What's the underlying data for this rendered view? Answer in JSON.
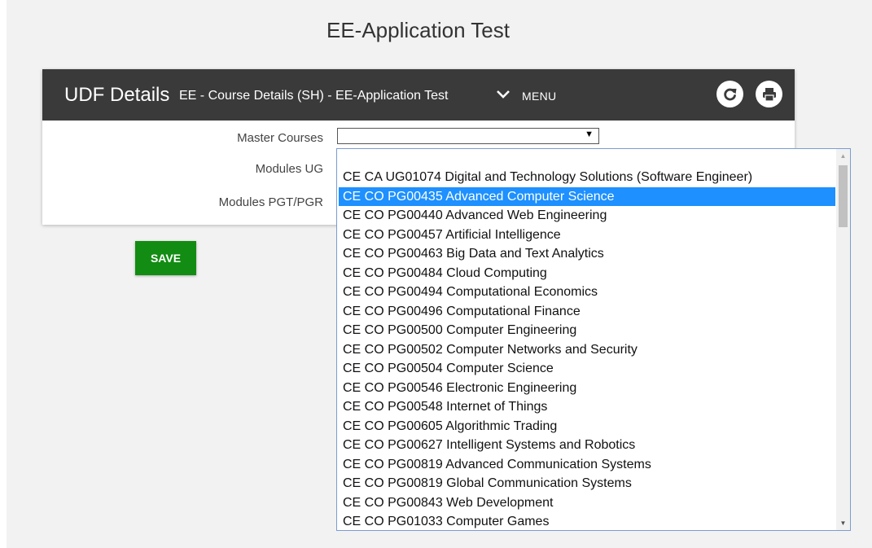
{
  "page": {
    "title": "EE-Application Test"
  },
  "header": {
    "title": "UDF Details",
    "subtitle": "EE - Course Details (SH) - EE-Application Test",
    "menu_label": "MENU",
    "chevron_icon": "chevron-down-icon",
    "refresh_icon": "refresh-icon",
    "print_icon": "print-icon",
    "background_color": "#3a3a3a"
  },
  "form": {
    "master_courses_label": "Master Courses",
    "modules_ug_label": "Modules UG",
    "modules_pgt_label": "Modules PGT/PGR",
    "master_courses_value": ""
  },
  "save_button": {
    "label": "SAVE",
    "color": "#128c12"
  },
  "dropdown": {
    "selected_index": 1,
    "selection_color": "#1e90ff",
    "options": [
      "CE CA UG01074 Digital and Technology Solutions (Software Engineer)",
      "CE CO PG00435 Advanced Computer Science",
      "CE CO PG00440 Advanced Web Engineering",
      "CE CO PG00457 Artificial Intelligence",
      "CE CO PG00463 Big Data and Text Analytics",
      "CE CO PG00484 Cloud Computing",
      "CE CO PG00494 Computational Economics",
      "CE CO PG00496 Computational Finance",
      "CE CO PG00500 Computer Engineering",
      "CE CO PG00502 Computer Networks and Security",
      "CE CO PG00504 Computer Science",
      "CE CO PG00546 Electronic Engineering",
      "CE CO PG00548 Internet of Things",
      "CE CO PG00605 Algorithmic Trading",
      "CE CO PG00627 Intelligent Systems and Robotics",
      "CE CO PG00819 Advanced Communication Systems",
      "CE CO PG00819 Global Communication Systems",
      "CE CO PG00843 Web Development",
      "CE CO PG01033 Computer Games"
    ]
  }
}
